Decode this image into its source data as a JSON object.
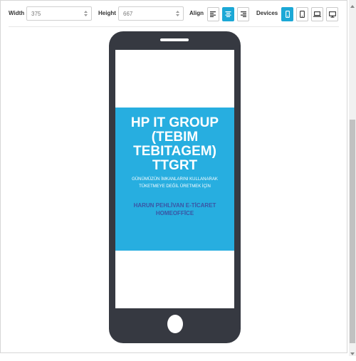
{
  "toolbar": {
    "width_label": "Width",
    "width_value": "375",
    "height_label": "Height",
    "height_value": "667",
    "align_label": "Align",
    "align_options": [
      "align-left",
      "align-center",
      "align-right"
    ],
    "align_selected": "align-center",
    "devices_label": "Devices",
    "device_options": [
      "phone",
      "tablet",
      "laptop",
      "desktop"
    ],
    "device_selected": "phone"
  },
  "preview": {
    "banner_title": "HP IT GROUP (TEBIM TEBITAGEM) TTGRT",
    "banner_subtitle": "GÜNÜMÜZÜN İMKANLARINI KULLANARAK TÜKETMEYE DEĞİL ÜRETMEK İÇİN",
    "banner_author": "HARUN PEHLİVAN E-TİCARET HOMEOFFİCE"
  },
  "colors": {
    "accent": "#1ba8d6",
    "phone_body": "#363941",
    "banner_bg": "#27aee0",
    "author_text": "#3a55a4"
  }
}
